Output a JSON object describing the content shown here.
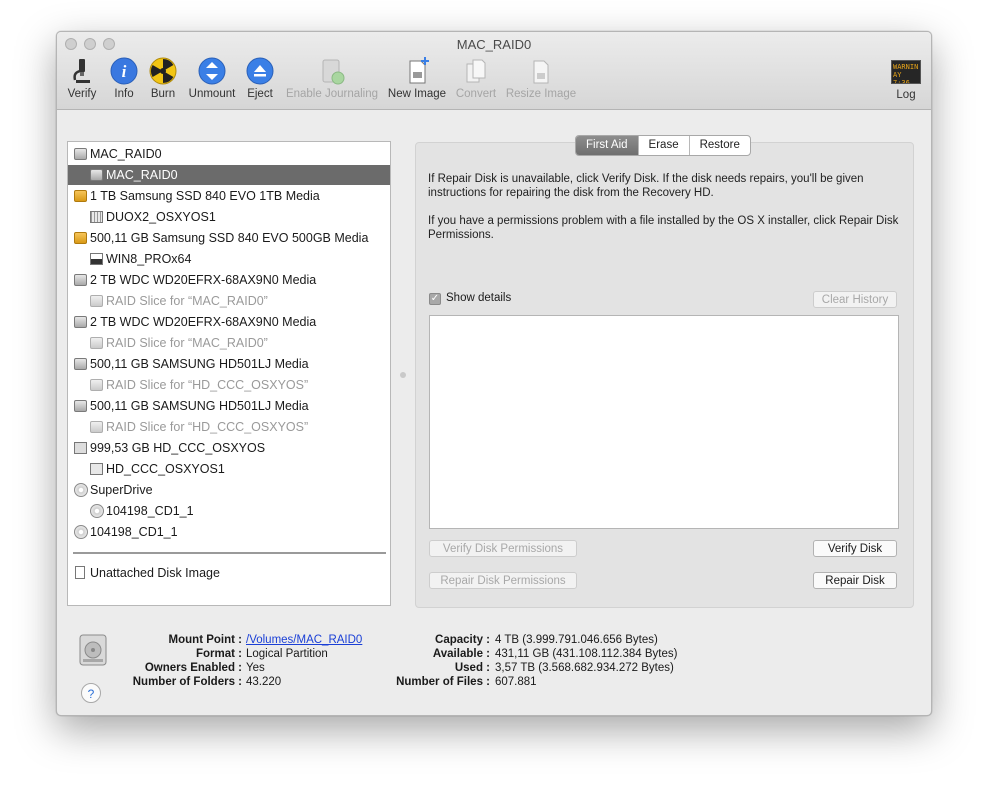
{
  "window": {
    "title": "MAC_RAID0"
  },
  "toolbar": {
    "verify": "Verify",
    "info": "Info",
    "burn": "Burn",
    "unmount": "Unmount",
    "eject": "Eject",
    "enable_journaling": "Enable Journaling",
    "new_image": "New Image",
    "convert": "Convert",
    "resize_image": "Resize Image",
    "log": "Log",
    "log_badge": "WARNIN AY 7:36"
  },
  "sidebar": {
    "items": [
      {
        "label": "MAC_RAID0",
        "icon": "raid-disk-icon"
      },
      {
        "label": "MAC_RAID0",
        "icon": "raid-volume-icon"
      },
      {
        "label": "1 TB Samsung SSD 840 EVO 1TB Media",
        "icon": "external-drive-icon"
      },
      {
        "label": "DUOX2_OSXYOS1",
        "icon": "ssd-volume-icon"
      },
      {
        "label": "500,11 GB Samsung SSD 840 EVO 500GB Media",
        "icon": "external-drive-icon"
      },
      {
        "label": "WIN8_PROx64",
        "icon": "windows-volume-icon"
      },
      {
        "label": "2 TB WDC WD20EFRX-68AX9N0 Media",
        "icon": "hard-disk-icon"
      },
      {
        "label": "RAID Slice for “MAC_RAID0”",
        "icon": "raid-slice-icon"
      },
      {
        "label": "2 TB WDC WD20EFRX-68AX9N0 Media",
        "icon": "hard-disk-icon"
      },
      {
        "label": "RAID Slice for “MAC_RAID0”",
        "icon": "raid-slice-icon"
      },
      {
        "label": "500,11 GB SAMSUNG HD501LJ Media",
        "icon": "hard-disk-icon"
      },
      {
        "label": "RAID Slice for “HD_CCC_OSXYOS”",
        "icon": "raid-slice-icon"
      },
      {
        "label": "500,11 GB SAMSUNG HD501LJ Media",
        "icon": "hard-disk-icon"
      },
      {
        "label": "RAID Slice for “HD_CCC_OSXYOS”",
        "icon": "raid-slice-icon"
      },
      {
        "label": "999,53 GB HD_CCC_OSXYOS",
        "icon": "raid-set-icon"
      },
      {
        "label": "HD_CCC_OSXYOS1",
        "icon": "volume-icon"
      },
      {
        "label": "SuperDrive",
        "icon": "optical-drive-icon"
      },
      {
        "label": "104198_CD1_1",
        "icon": "cd-icon"
      },
      {
        "label": "104198_CD1_1",
        "icon": "cd-icon"
      }
    ],
    "unattached": "Unattached Disk Image"
  },
  "tabs": {
    "first_aid": "First Aid",
    "erase": "Erase",
    "restore": "Restore"
  },
  "first_aid": {
    "para1": "If Repair Disk is unavailable, click Verify Disk. If the disk needs repairs, you'll be given instructions for repairing the disk from the Recovery HD.",
    "para2": "If you have a permissions problem with a file installed by the OS X installer, click Repair Disk Permissions.",
    "show_details": "Show details",
    "clear_history": "Clear History",
    "verify_permissions": "Verify Disk Permissions",
    "verify_disk": "Verify Disk",
    "repair_permissions": "Repair Disk Permissions",
    "repair_disk": "Repair Disk"
  },
  "info": {
    "mount_point_label": "Mount Point :",
    "mount_point": "/Volumes/MAC_RAID0",
    "format_label": "Format :",
    "format": "Logical Partition",
    "owners_label": "Owners Enabled :",
    "owners": "Yes",
    "folders_label": "Number of Folders :",
    "folders": "43.220",
    "capacity_label": "Capacity :",
    "capacity": "4 TB (3.999.791.046.656 Bytes)",
    "available_label": "Available :",
    "available": "431,11 GB (431.108.112.384 Bytes)",
    "used_label": "Used :",
    "used": "3,57 TB (3.568.682.934.272 Bytes)",
    "files_label": "Number of Files :",
    "files": "607.881"
  },
  "help": "?"
}
